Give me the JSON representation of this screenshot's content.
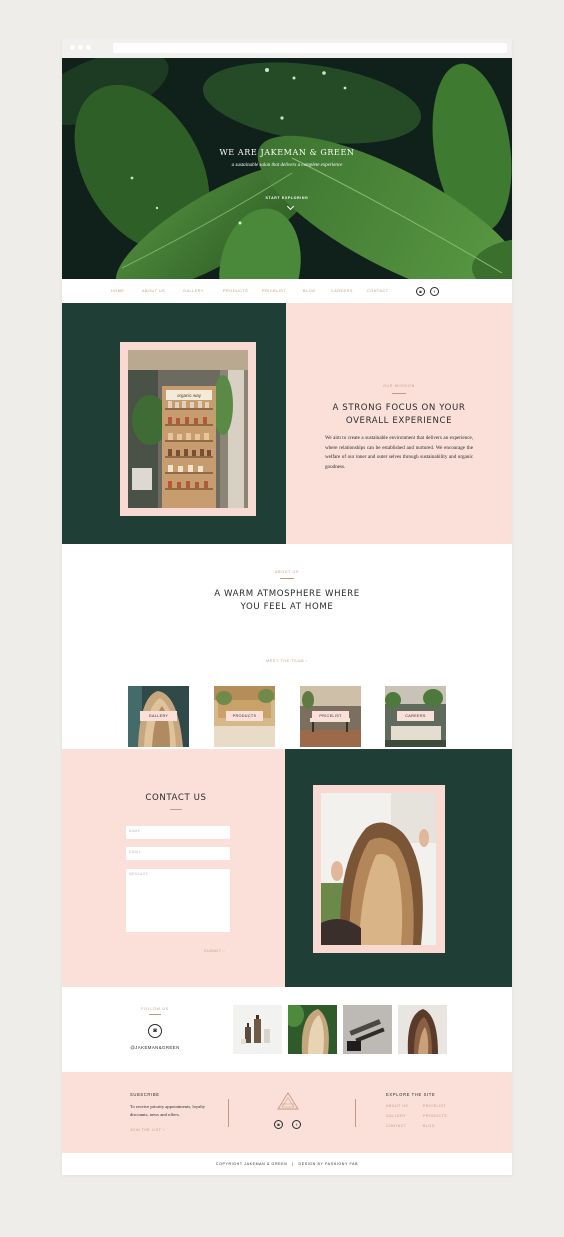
{
  "hero": {
    "title": "WE ARE JAKEMAN & GREEN",
    "subtitle": "a sustainable salon that delivers a complete experience",
    "cta": "START EXPLORING"
  },
  "nav": {
    "items": [
      "HOME",
      "ABOUT US",
      "GALLERY",
      "PRODUCTS",
      "PRICELIST",
      "BLOG",
      "CAREERS",
      "CONTACT"
    ],
    "social_icons": [
      "instagram-icon",
      "facebook-icon"
    ]
  },
  "mission": {
    "eyebrow": "OUR MISSION",
    "heading_line1": "A STRONG FOCUS ON YOUR",
    "heading_line2": "OVERALL EXPERIENCE",
    "body": "We aim to create a sustainable environment that delivers an experience, where relationships can be established and nurtured. We encourage the welfare of our inner and outer selves through sustainability and organic goodness.",
    "photo_sign": "organic way"
  },
  "about": {
    "eyebrow": "ABOUT US",
    "heading_line1": "A WARM ATMOSPHERE WHERE",
    "heading_line2": "YOU FEEL AT HOME",
    "link": "MEET THE TEAM",
    "tiles": [
      "GALLERY",
      "PRODUCTS",
      "PRICELIST",
      "CAREERS"
    ]
  },
  "contact": {
    "heading": "CONTACT US",
    "name_placeholder": "NAME",
    "email_placeholder": "EMAIL",
    "message_placeholder": "MESSAGE",
    "submit": "SUBMIT"
  },
  "instagram": {
    "eyebrow": "FOLLOW US",
    "handle": "@JAKEMAN&GREEN"
  },
  "footer": {
    "subscribe_title": "SUBSCRIBE",
    "subscribe_text": "To receive priority appointments, loyalty discounts, news and offers.",
    "join_link": "JOIN THE LIST",
    "explore_title": "EXPLORE THE SITE",
    "explore_links": [
      "ABOUT US",
      "PRICELIST",
      "GALLERY",
      "PRODUCTS",
      "CONTACT",
      "BLOG"
    ],
    "copyright": "COPYRIGHT JAKEMAN & GREEN",
    "design_credit": "DESIGN BY FASHIONY FAB"
  },
  "colors": {
    "dark_green": "#1f3f36",
    "blush": "#fbe0da",
    "accent": "#c39a80"
  }
}
